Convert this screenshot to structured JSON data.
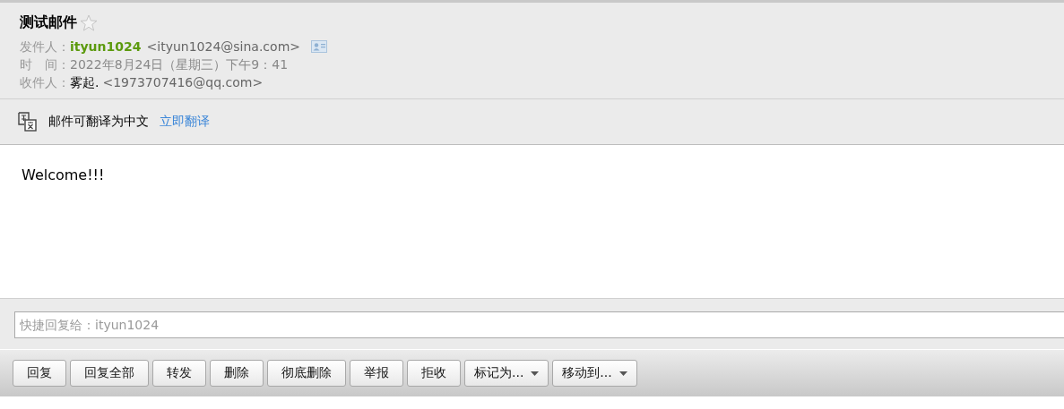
{
  "subject": "测试邮件",
  "starred": false,
  "header_fields": [
    {
      "kind": "sender",
      "label": "发件人：",
      "name": "ityun1024",
      "address": "<ityun1024@sina.com>"
    },
    {
      "kind": "time",
      "label": "时　间：",
      "value": "2022年8月24日（星期三）下午9：41"
    },
    {
      "kind": "recipient",
      "label": "收件人：",
      "name": "雾起.",
      "address": "<1973707416@qq.com>"
    }
  ],
  "translate_bar": {
    "message": "邮件可翻译为中文",
    "link": "立即翻译"
  },
  "body": "Welcome!!!",
  "quick_reply": {
    "placeholder": "快捷回复给：ityun1024"
  },
  "buttons": [
    {
      "label": "回复",
      "kind": "plain"
    },
    {
      "label": "回复全部",
      "kind": "plain"
    },
    {
      "label": "转发",
      "kind": "plain"
    },
    {
      "label": "删除",
      "kind": "plain"
    },
    {
      "label": "彻底删除",
      "kind": "plain"
    },
    {
      "label": "举报",
      "kind": "plain"
    },
    {
      "label": "拒收",
      "kind": "plain"
    },
    {
      "label": "标记为...",
      "kind": "menu"
    },
    {
      "label": "移动到...",
      "kind": "menu"
    }
  ]
}
